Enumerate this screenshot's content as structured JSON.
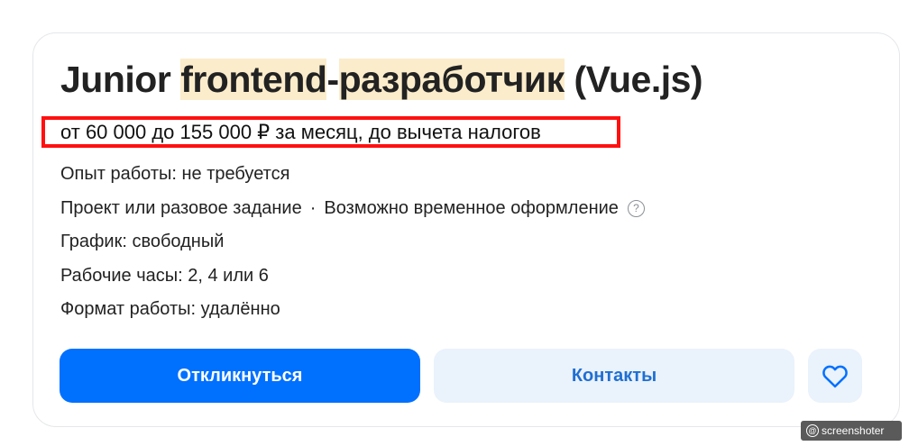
{
  "vacancy": {
    "title_parts": {
      "junior": "Junior ",
      "frontend": "frontend",
      "dash": "-",
      "developer": "разработчик",
      "vue": " (Vue.js)"
    },
    "salary": "от 60 000 до 155 000 ₽ за месяц, до вычета налогов",
    "experience": "Опыт работы: не требуется",
    "employment": "Проект или разовое задание",
    "separator": "·",
    "registration": "Возможно временное оформление",
    "help_icon_symbol": "?",
    "schedule": "График: свободный",
    "hours": "Рабочие часы: 2, 4 или 6",
    "format": "Формат работы: удалённо"
  },
  "actions": {
    "respond_label": "Откликнуться",
    "contacts_label": "Контакты",
    "favorite_icon": "heart-icon"
  },
  "watermark": {
    "text": "screenshoter",
    "icon_symbol": "@"
  },
  "colors": {
    "primary": "#0070ff",
    "secondary_bg": "#eaf2fc",
    "secondary_text": "#1f6fd1",
    "highlight": "#fbeccb",
    "annotation_border": "#ff1010"
  }
}
